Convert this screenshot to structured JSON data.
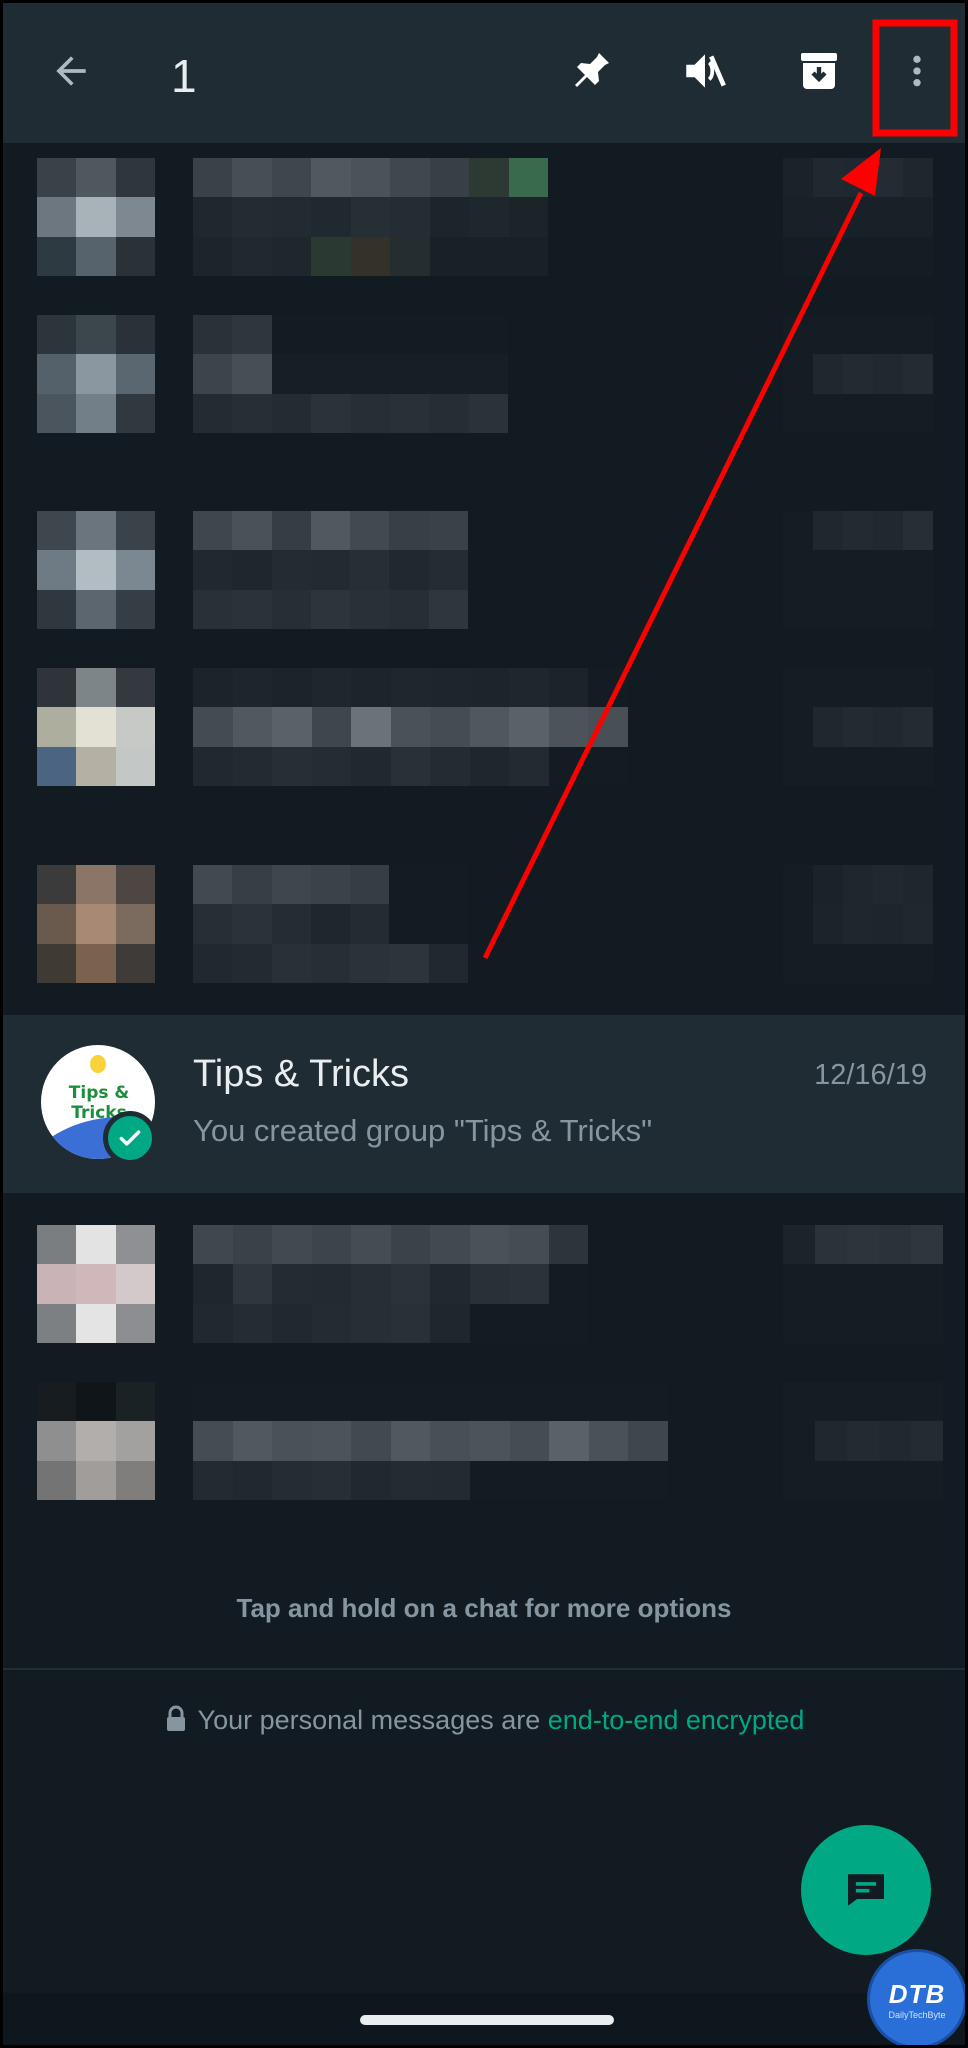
{
  "selection_bar": {
    "count": "1",
    "icons": [
      "back-arrow-icon",
      "pin-icon",
      "mute-icon",
      "archive-icon",
      "more-options-icon"
    ]
  },
  "highlighted_chat": {
    "name": "Tips & Tricks",
    "date": "12/16/19",
    "preview": "You created group \"Tips & Tricks\"",
    "avatar_text": "Tips & Tricks"
  },
  "hint": "Tap and hold on a chat for more options",
  "encryption": {
    "prefix": "Your personal messages are ",
    "link": "end-to-end encrypted"
  },
  "watermark": {
    "main": "DTB",
    "sub": "DailyTechByte"
  },
  "colors": {
    "background": "#111b21",
    "bar": "#1f2c34",
    "accent": "#00a884",
    "secondary_text": "#8696a0",
    "annotation": "#ff0000"
  }
}
